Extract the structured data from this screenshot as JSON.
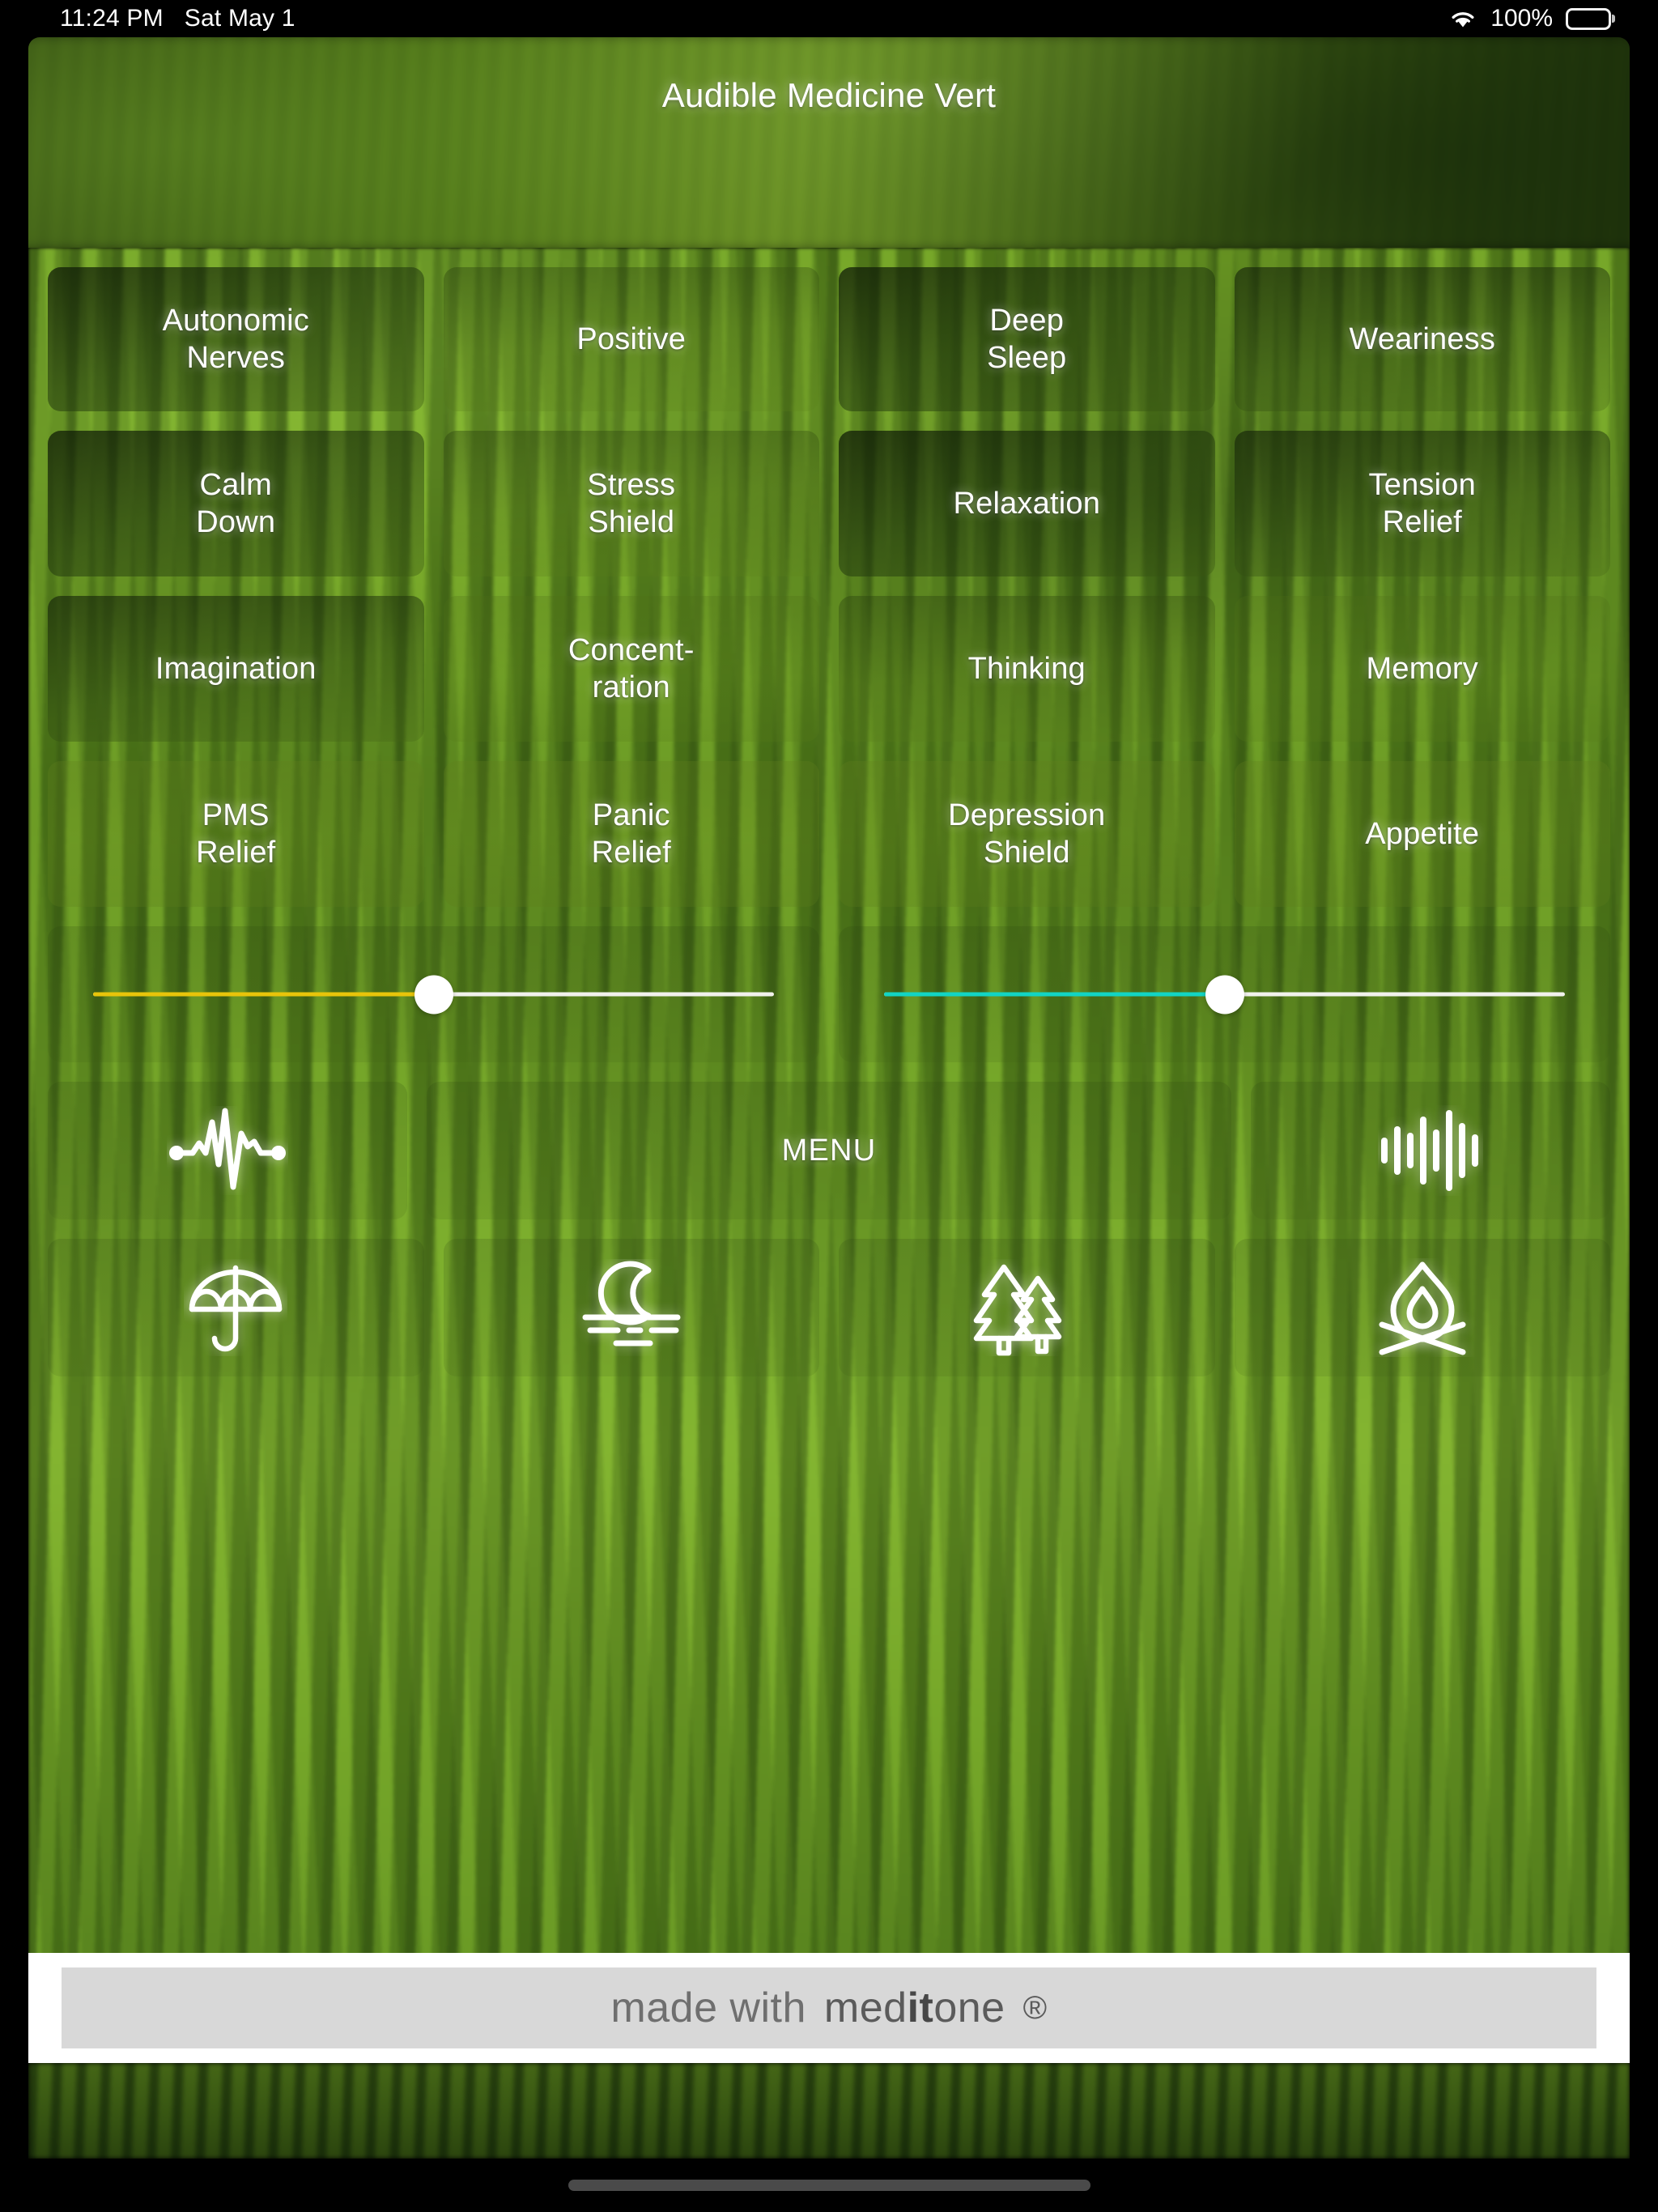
{
  "status_bar": {
    "time": "11:24 PM",
    "date": "Sat May 1",
    "wifi_icon": "wifi-icon",
    "battery_percent": "100%",
    "battery_icon": "battery-full-icon"
  },
  "header": {
    "title": "Audible Medicine Vert"
  },
  "grid": {
    "row1": [
      {
        "label": "Autonomic\nNerves",
        "name": "autonomic-nerves"
      },
      {
        "label": "Positive",
        "name": "positive"
      },
      {
        "label": "Deep\nSleep",
        "name": "deep-sleep"
      },
      {
        "label": "Weariness",
        "name": "weariness"
      }
    ],
    "row2": [
      {
        "label": "Calm\nDown",
        "name": "calm-down"
      },
      {
        "label": "Stress\nShield",
        "name": "stress-shield"
      },
      {
        "label": "Relaxation",
        "name": "relaxation"
      },
      {
        "label": "Tension\nRelief",
        "name": "tension-relief"
      }
    ],
    "row3": [
      {
        "label": "Imagination",
        "name": "imagination"
      },
      {
        "label": "Concent-\nration",
        "name": "concentration"
      },
      {
        "label": "Thinking",
        "name": "thinking"
      },
      {
        "label": "Memory",
        "name": "memory"
      }
    ],
    "row4": [
      {
        "label": "PMS\nRelief",
        "name": "pms-relief"
      },
      {
        "label": "Panic\nRelief",
        "name": "panic-relief"
      },
      {
        "label": "Depression\nShield",
        "name": "depression-shield"
      },
      {
        "label": "Appetite",
        "name": "appetite"
      }
    ]
  },
  "sliders": [
    {
      "name": "slider-left",
      "value": 50,
      "fill_color": "#e8c40a",
      "thumb_color": "#ffffff",
      "track_color": "#f1f1ec"
    },
    {
      "name": "slider-right",
      "value": 50,
      "fill_color": "#12d4c4",
      "thumb_color": "#ffffff",
      "track_color": "#f1f1ec"
    }
  ],
  "menu_row": {
    "left_icon": "pulse-waveform-icon",
    "menu_label": "MENU",
    "right_icon": "equalizer-bars-icon"
  },
  "scene_row": [
    {
      "name": "rain",
      "icon": "umbrella-icon"
    },
    {
      "name": "night",
      "icon": "moon-over-water-icon"
    },
    {
      "name": "forest",
      "icon": "pine-trees-icon"
    },
    {
      "name": "campfire",
      "icon": "campfire-icon"
    }
  ],
  "footer": {
    "made_with": "made with",
    "brand_prefix": "med",
    "brand_heavy": "it",
    "brand_suffix": "one",
    "registered_mark": "®"
  },
  "colors": {
    "accent_green": "#7aa82a",
    "banner_bg": "#d8d8d8",
    "banner_text": "#6f6f6f",
    "slider_yellow": "#e8c40a",
    "slider_cyan": "#12d4c4"
  }
}
